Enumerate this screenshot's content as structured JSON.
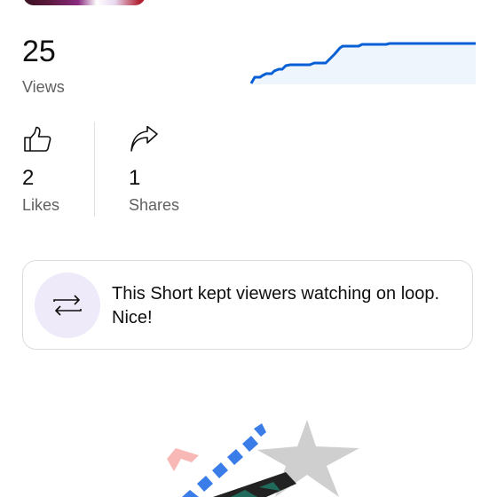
{
  "views": {
    "count": "25",
    "label": "Views"
  },
  "likes": {
    "count": "2",
    "label": "Likes",
    "icon": "thumbs-up-icon"
  },
  "shares": {
    "count": "1",
    "label": "Shares",
    "icon": "share-arrow-icon"
  },
  "insight": {
    "text": "This Short kept viewers watching on loop. Nice!",
    "icon": "loop-icon",
    "icon_bg": "#eeeaf9"
  },
  "colors": {
    "accent": "#065fd4",
    "sparkline_fill": "#eef5fd"
  }
}
